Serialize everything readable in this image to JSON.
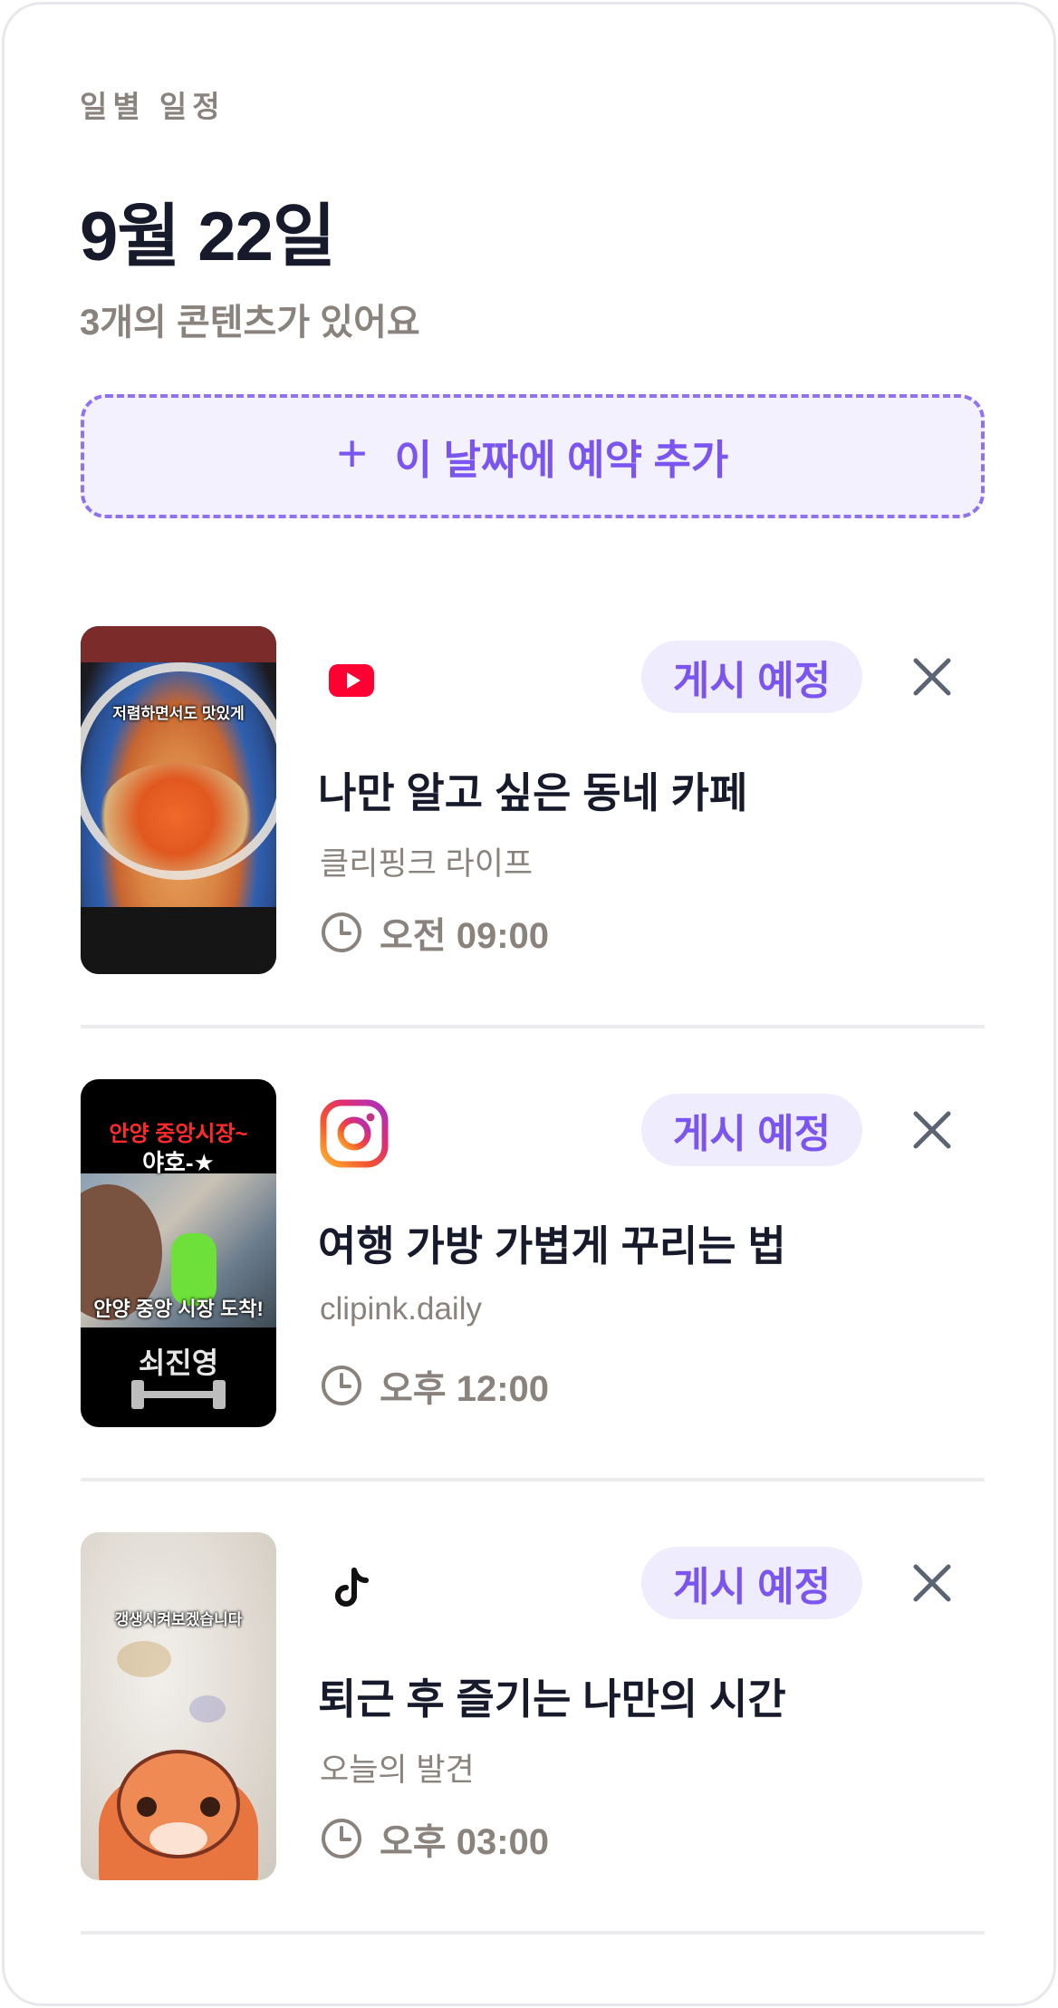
{
  "header": {
    "section_label": "일별 일정",
    "date_title": "9월 22일",
    "count_text": "3개의 콘텐츠가 있어요",
    "add_button_label": "이 날짜에 예약 추가",
    "accent_color": "#7a55f0"
  },
  "items": [
    {
      "platform": "youtube-icon",
      "status": "게시 예정",
      "title": "나만 알고 싶은 동네 카페",
      "account": "클리핑크 라이프",
      "time": "오전 09:00",
      "thumbnail_caption": "저렴하면서도 맛있게"
    },
    {
      "platform": "instagram-icon",
      "status": "게시 예정",
      "title": "여행 가방 가볍게 꾸리는 법",
      "account": "clipink.daily",
      "time": "오후 12:00",
      "thumbnail_caption_top_red": "안양 중앙시장~",
      "thumbnail_caption_top_white": "야호-★",
      "thumbnail_caption_mid": "안양 중앙 시장 도착!",
      "thumbnail_caption_bottom": "쇠진영"
    },
    {
      "platform": "tiktok-icon",
      "status": "게시 예정",
      "title": "퇴근 후 즐기는 나만의 시간",
      "account": "오늘의 발견",
      "time": "오후 03:00",
      "thumbnail_caption": "갱생시켜보겠습니다"
    }
  ]
}
